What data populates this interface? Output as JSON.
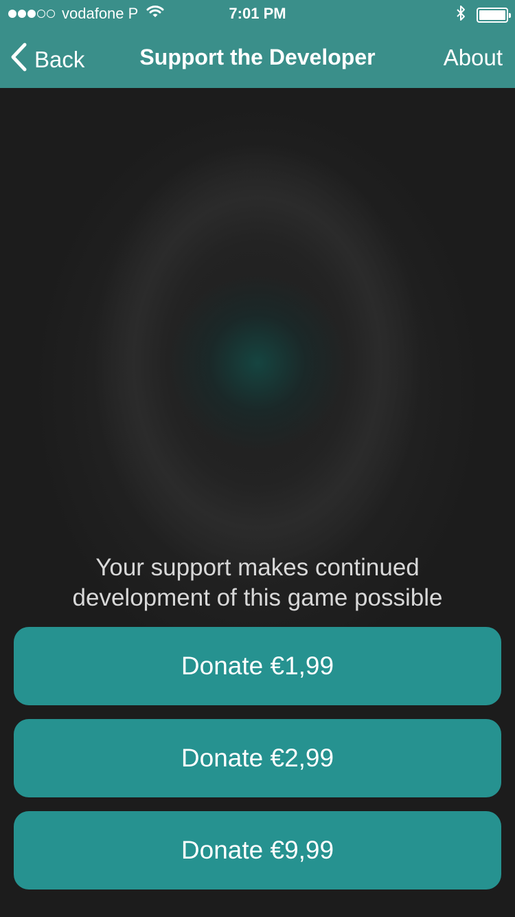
{
  "status_bar": {
    "carrier": "vodafone P",
    "time": "7:01 PM",
    "signal_bars": 3,
    "signal_total": 5,
    "icons": [
      "wifi-icon",
      "bluetooth-icon",
      "battery-icon"
    ]
  },
  "nav": {
    "back_label": "Back",
    "title": "Support the Developer",
    "about_label": "About"
  },
  "main": {
    "tagline_line1": "Your support makes continued",
    "tagline_line2": "development of this game possible",
    "donations": [
      {
        "label": "Donate €1,99"
      },
      {
        "label": "Donate €2,99"
      },
      {
        "label": "Donate €9,99"
      }
    ]
  },
  "colors": {
    "bar": "#3a8f8a",
    "button": "#269290",
    "background": "#1a1a1a"
  }
}
